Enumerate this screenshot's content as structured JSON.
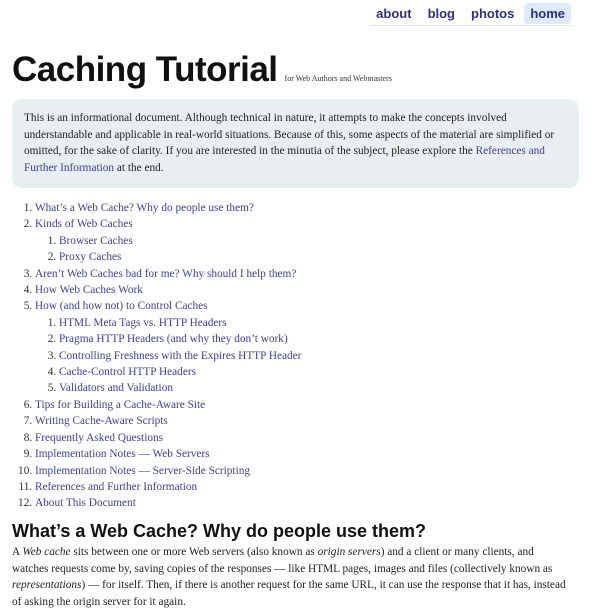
{
  "nav": {
    "items": [
      {
        "label": "about",
        "active": false
      },
      {
        "label": "blog",
        "active": false
      },
      {
        "label": "photos",
        "active": false
      },
      {
        "label": "home",
        "active": true
      }
    ]
  },
  "header": {
    "title": "Caching Tutorial",
    "subtitle": "for Web Authors and Webmasters"
  },
  "intro": {
    "text_before_link": "This is an informational document. Although technical in nature, it attempts to make the concepts involved understandable and applicable in real-world situations. Because of this, some aspects of the material are simplified or omitted, for the sake of clarity. If you are interested in the minutia of the subject, please explore the ",
    "link_label": "References and Further Information",
    "text_after_link": " at the end."
  },
  "toc": {
    "items": [
      {
        "label": "What’s a Web Cache? Why do people use them?"
      },
      {
        "label": "Kinds of Web Caches",
        "children": [
          "Browser Caches",
          "Proxy Caches"
        ]
      },
      {
        "label": "Aren’t Web Caches bad for me? Why should I help them?"
      },
      {
        "label": "How Web Caches Work"
      },
      {
        "label": "How (and how not) to Control Caches",
        "children": [
          "HTML Meta Tags vs. HTTP Headers",
          "Pragma HTTP Headers (and why they don’t work)",
          "Controlling Freshness with the Expires HTTP Header",
          "Cache-Control HTTP Headers",
          "Validators and Validation"
        ]
      },
      {
        "label": "Tips for Building a Cache-Aware Site"
      },
      {
        "label": "Writing Cache-Aware Scripts"
      },
      {
        "label": "Frequently Asked Questions"
      },
      {
        "label": "Implementation Notes — Web Servers"
      },
      {
        "label": "Implementation Notes — Server-Side Scripting"
      },
      {
        "label": "References and Further Information"
      },
      {
        "label": "About This Document"
      }
    ]
  },
  "section1": {
    "heading": "What’s a Web Cache? Why do people use them?",
    "p_a": "A ",
    "p_em1": "Web cache",
    "p_b": " sits between one or more Web servers (also known as ",
    "p_em2": "origin servers",
    "p_c": ") and a client or many clients, and watches requests come by, saving copies of the responses — like HTML pages, images and files (collectively known as ",
    "p_em3": "representations",
    "p_d": ") — for itself. Then, if there is another request for the same URL, it can use the response that it has, instead of asking the origin server for it again."
  }
}
